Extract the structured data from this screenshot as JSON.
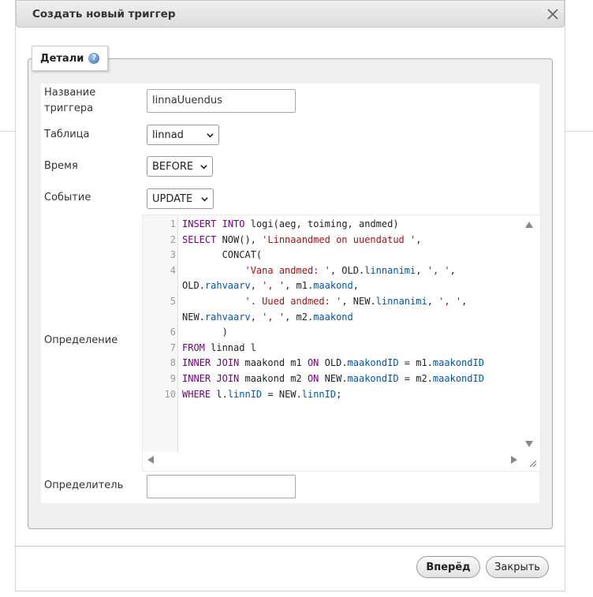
{
  "dialog": {
    "title": "Создать новый триггер",
    "close_icon": "close-icon"
  },
  "fieldset": {
    "legend": "Детали",
    "help_icon": "help-icon",
    "help_glyph": "?"
  },
  "form": {
    "name_label": "Название триггера",
    "name_value": "linnaUuendus",
    "table_label": "Таблица",
    "table_value": "linnad",
    "time_label": "Время",
    "time_value": "BEFORE",
    "event_label": "Событие",
    "event_value": "UPDATE",
    "definition_label": "Определение",
    "definer_label": "Определитель",
    "definer_value": ""
  },
  "editor": {
    "line_numbers": [
      "1",
      "2",
      "3",
      "4",
      "5",
      "6",
      "7",
      "8",
      "9",
      "10"
    ],
    "rows": [
      {
        "num": "1",
        "tokens": [
          {
            "t": "INSERT",
            "c": "kw"
          },
          {
            "t": " ",
            "c": "pl"
          },
          {
            "t": "INTO",
            "c": "kw"
          },
          {
            "t": " logi(aeg, toiming, andmed)",
            "c": "pl"
          }
        ]
      },
      {
        "num": "2",
        "tokens": [
          {
            "t": "SELECT",
            "c": "kw"
          },
          {
            "t": " NOW(), ",
            "c": "pl"
          },
          {
            "t": "'Linnaandmed on uuendatud '",
            "c": "str"
          },
          {
            "t": ",",
            "c": "pl"
          }
        ]
      },
      {
        "num": "3",
        "tokens": [
          {
            "t": "       CONCAT(",
            "c": "pl"
          }
        ]
      },
      {
        "num": "4",
        "tokens": [
          {
            "t": "           ",
            "c": "pl"
          },
          {
            "t": "'Vana andmed: '",
            "c": "str"
          },
          {
            "t": ", OLD.",
            "c": "pl"
          },
          {
            "t": "linnanimi",
            "c": "prop"
          },
          {
            "t": ", ",
            "c": "pl"
          },
          {
            "t": "', '",
            "c": "str"
          },
          {
            "t": ",",
            "c": "pl"
          }
        ]
      },
      {
        "num": "",
        "tokens": [
          {
            "t": "OLD.",
            "c": "pl"
          },
          {
            "t": "rahvaarv",
            "c": "prop"
          },
          {
            "t": ", ",
            "c": "pl"
          },
          {
            "t": "', '",
            "c": "str"
          },
          {
            "t": ", m1.",
            "c": "pl"
          },
          {
            "t": "maakond",
            "c": "prop"
          },
          {
            "t": ",",
            "c": "pl"
          }
        ]
      },
      {
        "num": "5",
        "tokens": [
          {
            "t": "           ",
            "c": "pl"
          },
          {
            "t": "'. Uued andmed: '",
            "c": "str"
          },
          {
            "t": ", NEW.",
            "c": "pl"
          },
          {
            "t": "linnanimi",
            "c": "prop"
          },
          {
            "t": ", ",
            "c": "pl"
          },
          {
            "t": "', '",
            "c": "str"
          },
          {
            "t": ",",
            "c": "pl"
          }
        ]
      },
      {
        "num": "",
        "tokens": [
          {
            "t": "NEW.",
            "c": "pl"
          },
          {
            "t": "rahvaarv",
            "c": "prop"
          },
          {
            "t": ", ",
            "c": "pl"
          },
          {
            "t": "', '",
            "c": "str"
          },
          {
            "t": ", m2.",
            "c": "pl"
          },
          {
            "t": "maakond",
            "c": "prop"
          }
        ]
      },
      {
        "num": "6",
        "tokens": [
          {
            "t": "       )",
            "c": "pl"
          }
        ]
      },
      {
        "num": "7",
        "tokens": [
          {
            "t": "FROM",
            "c": "kw"
          },
          {
            "t": " linnad l",
            "c": "pl"
          }
        ]
      },
      {
        "num": "8",
        "tokens": [
          {
            "t": "INNER JOIN",
            "c": "kw"
          },
          {
            "t": " maakond m1 ",
            "c": "pl"
          },
          {
            "t": "ON",
            "c": "kw"
          },
          {
            "t": " OLD.",
            "c": "pl"
          },
          {
            "t": "maakondID",
            "c": "prop"
          },
          {
            "t": " = m1.",
            "c": "pl"
          },
          {
            "t": "maakondID",
            "c": "prop"
          }
        ]
      },
      {
        "num": "9",
        "tokens": [
          {
            "t": "INNER JOIN",
            "c": "kw"
          },
          {
            "t": " maakond m2 ",
            "c": "pl"
          },
          {
            "t": "ON",
            "c": "kw"
          },
          {
            "t": " NEW.",
            "c": "pl"
          },
          {
            "t": "maakondID",
            "c": "prop"
          },
          {
            "t": " = m2.",
            "c": "pl"
          },
          {
            "t": "maakondID",
            "c": "prop"
          }
        ]
      },
      {
        "num": "10",
        "tokens": [
          {
            "t": "WHERE",
            "c": "kw"
          },
          {
            "t": " l.",
            "c": "pl"
          },
          {
            "t": "linnID",
            "c": "prop"
          },
          {
            "t": " = NEW.",
            "c": "pl"
          },
          {
            "t": "linnID",
            "c": "prop"
          },
          {
            "t": ";",
            "c": "pl"
          }
        ]
      }
    ]
  },
  "buttons": {
    "next_label": "Вперёд",
    "close_label": "Закрыть"
  }
}
